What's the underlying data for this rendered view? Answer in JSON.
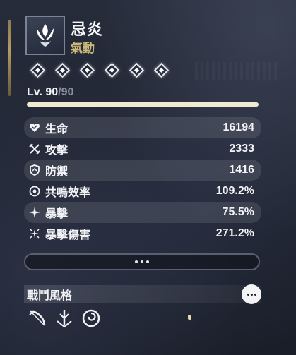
{
  "character": {
    "name": "忌炎",
    "weapon_type": "氣動",
    "element_icon": "aero-element-icon",
    "resonance_chain_nodes": 6
  },
  "level": {
    "prefix": "Lv. ",
    "current": "90",
    "separator": "/",
    "max": "90",
    "progress": 1.0
  },
  "stats": [
    {
      "icon": "heart-icon",
      "label": "生命",
      "value": "16194"
    },
    {
      "icon": "sword-icon",
      "label": "攻擊",
      "value": "2333"
    },
    {
      "icon": "shield-icon",
      "label": "防禦",
      "value": "1416"
    },
    {
      "icon": "energy-icon",
      "label": "共鳴效率",
      "value": "109.2%"
    },
    {
      "icon": "crit-icon",
      "label": "暴擊",
      "value": "75.5%"
    },
    {
      "icon": "crit-damage-icon",
      "label": "暴擊傷害",
      "value": "271.2%"
    }
  ],
  "combat_style": {
    "title": "戰鬥風格",
    "icons": [
      "bow-icon",
      "sword-down-icon",
      "swirl-icon"
    ]
  },
  "colors": {
    "accent_gold": "#c9b87a",
    "level_bar_fill": "#f1ead2"
  }
}
